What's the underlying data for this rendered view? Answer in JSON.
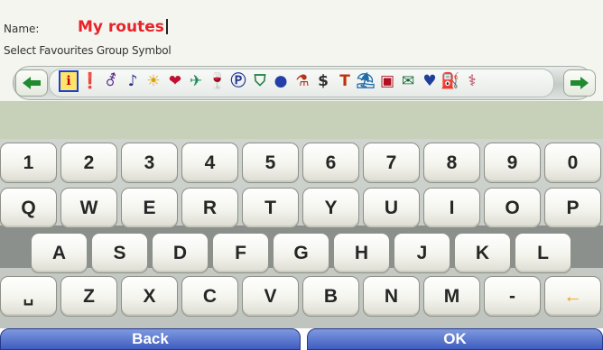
{
  "header": {
    "name_label": "Name:",
    "name_value": "My routes",
    "group_label": "Select Favourites Group Symbol"
  },
  "symbols": {
    "prev_arrow": "←",
    "next_arrow": "→",
    "items": [
      {
        "glyph": "ℹ",
        "icon": "info-icon",
        "color": "#c00000",
        "selected": true
      },
      {
        "glyph": "❗",
        "icon": "exclamation-icon",
        "color": "#c01020"
      },
      {
        "glyph": "⚦",
        "icon": "person-walking-icon",
        "color": "#5b2a88"
      },
      {
        "glyph": "♪",
        "icon": "music-icon",
        "color": "#2b2b8a"
      },
      {
        "glyph": "☀",
        "icon": "sun-icon",
        "color": "#e0a000"
      },
      {
        "glyph": "❤",
        "icon": "heart-icon",
        "color": "#c01030"
      },
      {
        "glyph": "✈",
        "icon": "airplane-icon",
        "color": "#1e8a5c"
      },
      {
        "glyph": "🍷",
        "icon": "wine-glass-icon",
        "color": "#b04010"
      },
      {
        "glyph": "Ⓟ",
        "icon": "parking-icon",
        "color": "#233a99"
      },
      {
        "glyph": "⛉",
        "icon": "shield-icon",
        "color": "#1c7a3c"
      },
      {
        "glyph": "●",
        "icon": "circle-icon",
        "color": "#2440a8"
      },
      {
        "glyph": "⚗",
        "icon": "chemistry-icon",
        "color": "#b8301a"
      },
      {
        "glyph": "$",
        "icon": "money-icon",
        "color": "#2e2e2e"
      },
      {
        "glyph": "T",
        "icon": "monument-icon",
        "color": "#c03010"
      },
      {
        "glyph": "⛱",
        "icon": "beach-icon",
        "color": "#1f6aa8"
      },
      {
        "glyph": "▣",
        "icon": "card-icon",
        "color": "#b01020"
      },
      {
        "glyph": "✉",
        "icon": "envelope-icon",
        "color": "#1b6a3a"
      },
      {
        "glyph": "♥",
        "icon": "heart-blue-icon",
        "color": "#1f3f9a"
      },
      {
        "glyph": "⛽",
        "icon": "fuel-pump-icon",
        "color": "#c01818"
      },
      {
        "glyph": "⚕",
        "icon": "medical-icon",
        "color": "#b01838"
      }
    ]
  },
  "keyboard": {
    "rows": [
      [
        "1",
        "2",
        "3",
        "4",
        "5",
        "6",
        "7",
        "8",
        "9",
        "0"
      ],
      [
        "Q",
        "W",
        "E",
        "R",
        "T",
        "Y",
        "U",
        "I",
        "O",
        "P"
      ],
      [
        "A",
        "S",
        "D",
        "F",
        "G",
        "H",
        "J",
        "K",
        "L"
      ],
      [
        "␣",
        "Z",
        "X",
        "C",
        "V",
        "B",
        "N",
        "M",
        "-",
        "←"
      ]
    ]
  },
  "buttons": {
    "back_label": "Back",
    "ok_label": "OK"
  },
  "colors": {
    "name_value": "#e8232a",
    "arrow_green": "#1f8a2e",
    "backspace_orange": "#f3a516",
    "button_blue": "#3f5dc0",
    "band_olive": "#c7d0b8"
  }
}
